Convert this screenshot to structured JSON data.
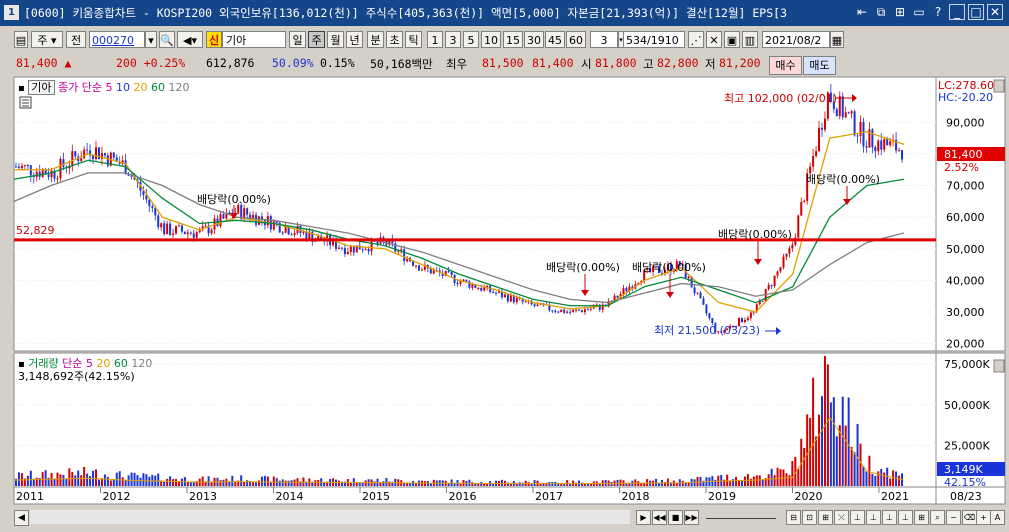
{
  "window": {
    "icon_num": "1",
    "title": "[0600] 키움종합차트 - KOSPI200 외국인보유[136,012(천)] 주식수[405,363(천)] 액면[5,000] 자본금[21,393(억)] 결산[12월] EPS[3"
  },
  "toolbar": {
    "joo": "주",
    "jeon": "전",
    "code": "000270",
    "sin": "신",
    "name": "기아",
    "periods": [
      "일",
      "주",
      "월",
      "년",
      "분",
      "초",
      "틱"
    ],
    "minutes": [
      "1",
      "3",
      "5",
      "10",
      "15",
      "30",
      "45",
      "60"
    ],
    "interval": "3",
    "count": "534",
    "total": "/1910",
    "date": "2021/08/2"
  },
  "quote": {
    "price": "81,400 ▲",
    "change": "200 +0.25%",
    "volume": "612,876",
    "ratio1": "50.09%",
    "ratio2": "0.15%",
    "amount": "50,168백만",
    "best_label": "최우",
    "bid1": "81,500",
    "bid2": "81,400",
    "open_label": "시",
    "open": "81,800",
    "high_label": "고",
    "high": "82,800",
    "low_label": "저",
    "low": "81,200",
    "buy": "매수",
    "sell": "매도"
  },
  "price_panel": {
    "legend": {
      "name": "기아",
      "ma_label": "종가 단순",
      "ma1": "5",
      "ma2": "10",
      "ma3": "20",
      "ma4": "60",
      "ma5": "120"
    },
    "lc": "LC:278.60",
    "hc": "HC:-20.20",
    "current_price": "81,400",
    "current_pct": "2.52%",
    "hline_value": "52,829",
    "annotations": {
      "high": "최고 102,000 (02/01)",
      "low": "최저 21,500 (03/23)",
      "div1": "배당락(0.00%)",
      "div2": "배당락(0.00%)",
      "div3": "배당락(0.00%)",
      "div4": "배당락(0.00%)",
      "div5": "배당락(0.00%)"
    },
    "yticks": [
      "90,000",
      "80,000",
      "70,000",
      "60,000",
      "50,000",
      "40,000",
      "30,000",
      "20,000"
    ]
  },
  "volume_panel": {
    "legend": {
      "name": "거래량",
      "ma_label": "단순",
      "ma1": "5",
      "ma2": "20",
      "ma3": "60",
      "ma4": "120"
    },
    "current": "3,148,692주(42.15%)",
    "yticks": [
      "75,000K",
      "50,000K",
      "25,000K"
    ],
    "current_badge": "3,149K",
    "current_pct": "42.15%"
  },
  "xaxis": {
    "years": [
      "2011",
      "2012",
      "2013",
      "2014",
      "2015",
      "2016",
      "2017",
      "2018",
      "2019",
      "2020",
      "2021"
    ],
    "last_label": "08/23"
  },
  "colors": {
    "price_up": "#d00000",
    "price_down": "#1a34d8",
    "ma5": "#c0009c",
    "ma10": "#1a34d8",
    "ma20": "#e0a000",
    "ma60": "#008a3a",
    "ma120": "#7f7f7f"
  },
  "chart_data": {
    "type": "line",
    "x": [
      "2011",
      "2011.5",
      "2012",
      "2012.5",
      "2013",
      "2013.5",
      "2014",
      "2014.5",
      "2015",
      "2015.5",
      "2016",
      "2016.5",
      "2017",
      "2017.5",
      "2018",
      "2018.5",
      "2019",
      "2019.5",
      "2020",
      "2020.25",
      "2020.5",
      "2020.75",
      "2021",
      "2021.3",
      "2021.6"
    ],
    "series": [
      {
        "name": "종가",
        "values": [
          76000,
          74000,
          82000,
          76000,
          56000,
          55000,
          62000,
          58000,
          54000,
          50000,
          52000,
          44000,
          40000,
          36000,
          32000,
          30000,
          32000,
          42000,
          45000,
          23000,
          30000,
          50000,
          99000,
          85000,
          81400
        ]
      },
      {
        "name": "20",
        "values": [
          75000,
          75000,
          80000,
          77000,
          60000,
          56000,
          60000,
          58000,
          55000,
          51000,
          50000,
          45000,
          40000,
          37000,
          33000,
          31000,
          32000,
          40000,
          44000,
          33000,
          30000,
          42000,
          85000,
          87000,
          83000
        ]
      },
      {
        "name": "60",
        "values": [
          72000,
          74000,
          78000,
          76000,
          66000,
          58000,
          59000,
          58000,
          56000,
          53000,
          51000,
          47000,
          42000,
          38000,
          34000,
          32000,
          32000,
          38000,
          41000,
          37000,
          33000,
          38000,
          60000,
          70000,
          72000
        ]
      },
      {
        "name": "120",
        "values": [
          65000,
          70000,
          74000,
          74000,
          70000,
          64000,
          60000,
          59000,
          57000,
          55000,
          52000,
          49000,
          45000,
          41000,
          37000,
          34000,
          33000,
          36000,
          39000,
          38000,
          35000,
          37000,
          45000,
          52000,
          55000
        ]
      }
    ],
    "ylim": [
      18000,
      104000
    ],
    "hline": 52829,
    "volume": [
      6000,
      7000,
      8000,
      6000,
      5000,
      4000,
      4500,
      4000,
      3800,
      3500,
      3500,
      3000,
      2800,
      2600,
      2500,
      2400,
      2600,
      3000,
      3200,
      5000,
      6000,
      9000,
      70000,
      15000,
      6000
    ],
    "volume_ylim": [
      0,
      80000
    ]
  }
}
